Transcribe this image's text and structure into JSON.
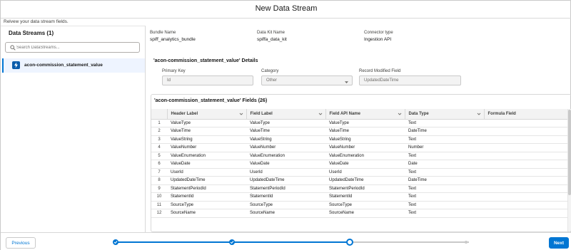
{
  "header": {
    "title": "New Data Stream"
  },
  "subtitle": "Relvew your data stream fields.",
  "sidebar": {
    "title": "Data Streams (1)",
    "search_placeholder": "Search DataStreams...",
    "items": [
      {
        "label": "acon-commission_statement_value",
        "icon": "lightning-bolt-icon"
      }
    ]
  },
  "meta": {
    "bundle_name_label": "Bundle Name",
    "bundle_name": "spiff_analytics_bundle",
    "data_kit_label": "Data Kit Name",
    "data_kit": "spiffa_data_kit",
    "connector_label": "Connector type",
    "connector": "Ingestion API"
  },
  "details": {
    "title": "'acon-commission_statement_value' Details",
    "primary_key_label": "Primary Key",
    "primary_key": "Id",
    "category_label": "Category",
    "category": "Other",
    "record_modified_label": "Record Modified Field",
    "record_modified": "UpdatedDateTime"
  },
  "fields": {
    "title": "'acon-commission_statement_value' Fields (26)",
    "columns": [
      "Header Label",
      "Field Label",
      "Field API Name",
      "Data Type",
      "Formula Field"
    ],
    "rows": [
      [
        "1",
        "ValueType",
        "ValueType",
        "ValueType",
        "Text"
      ],
      [
        "2",
        "ValueTime",
        "ValueTime",
        "ValueTime",
        "DateTime"
      ],
      [
        "3",
        "ValueString",
        "ValueString",
        "ValueString",
        "Text"
      ],
      [
        "4",
        "ValueNumber",
        "ValueNumber",
        "ValueNumber",
        "Number"
      ],
      [
        "5",
        "ValueEnumeration",
        "ValueEnumeration",
        "ValueEnumeration",
        "Text"
      ],
      [
        "6",
        "ValueDate",
        "ValueDate",
        "ValueDate",
        "Date"
      ],
      [
        "7",
        "UserId",
        "UserId",
        "UserId",
        "Text"
      ],
      [
        "8",
        "UpdatedDateTime",
        "UpdatedDateTime",
        "UpdatedDateTime",
        "DateTime"
      ],
      [
        "9",
        "StatementPeriodId",
        "StatementPeriodId",
        "StatementPeriodId",
        "Text"
      ],
      [
        "10",
        "StatementId",
        "StatementId",
        "StatementId",
        "Text"
      ],
      [
        "11",
        "SourceType",
        "SourceType",
        "SourceType",
        "Text"
      ],
      [
        "12",
        "SourceName",
        "SourceName",
        "SourceName",
        "Text"
      ]
    ]
  },
  "footer": {
    "previous_label": "Previous",
    "next_label": "Next",
    "steps_completed": 3,
    "steps_total": 4
  },
  "colors": {
    "accent": "#0176d3",
    "header_bg": "#f3f3f3"
  }
}
